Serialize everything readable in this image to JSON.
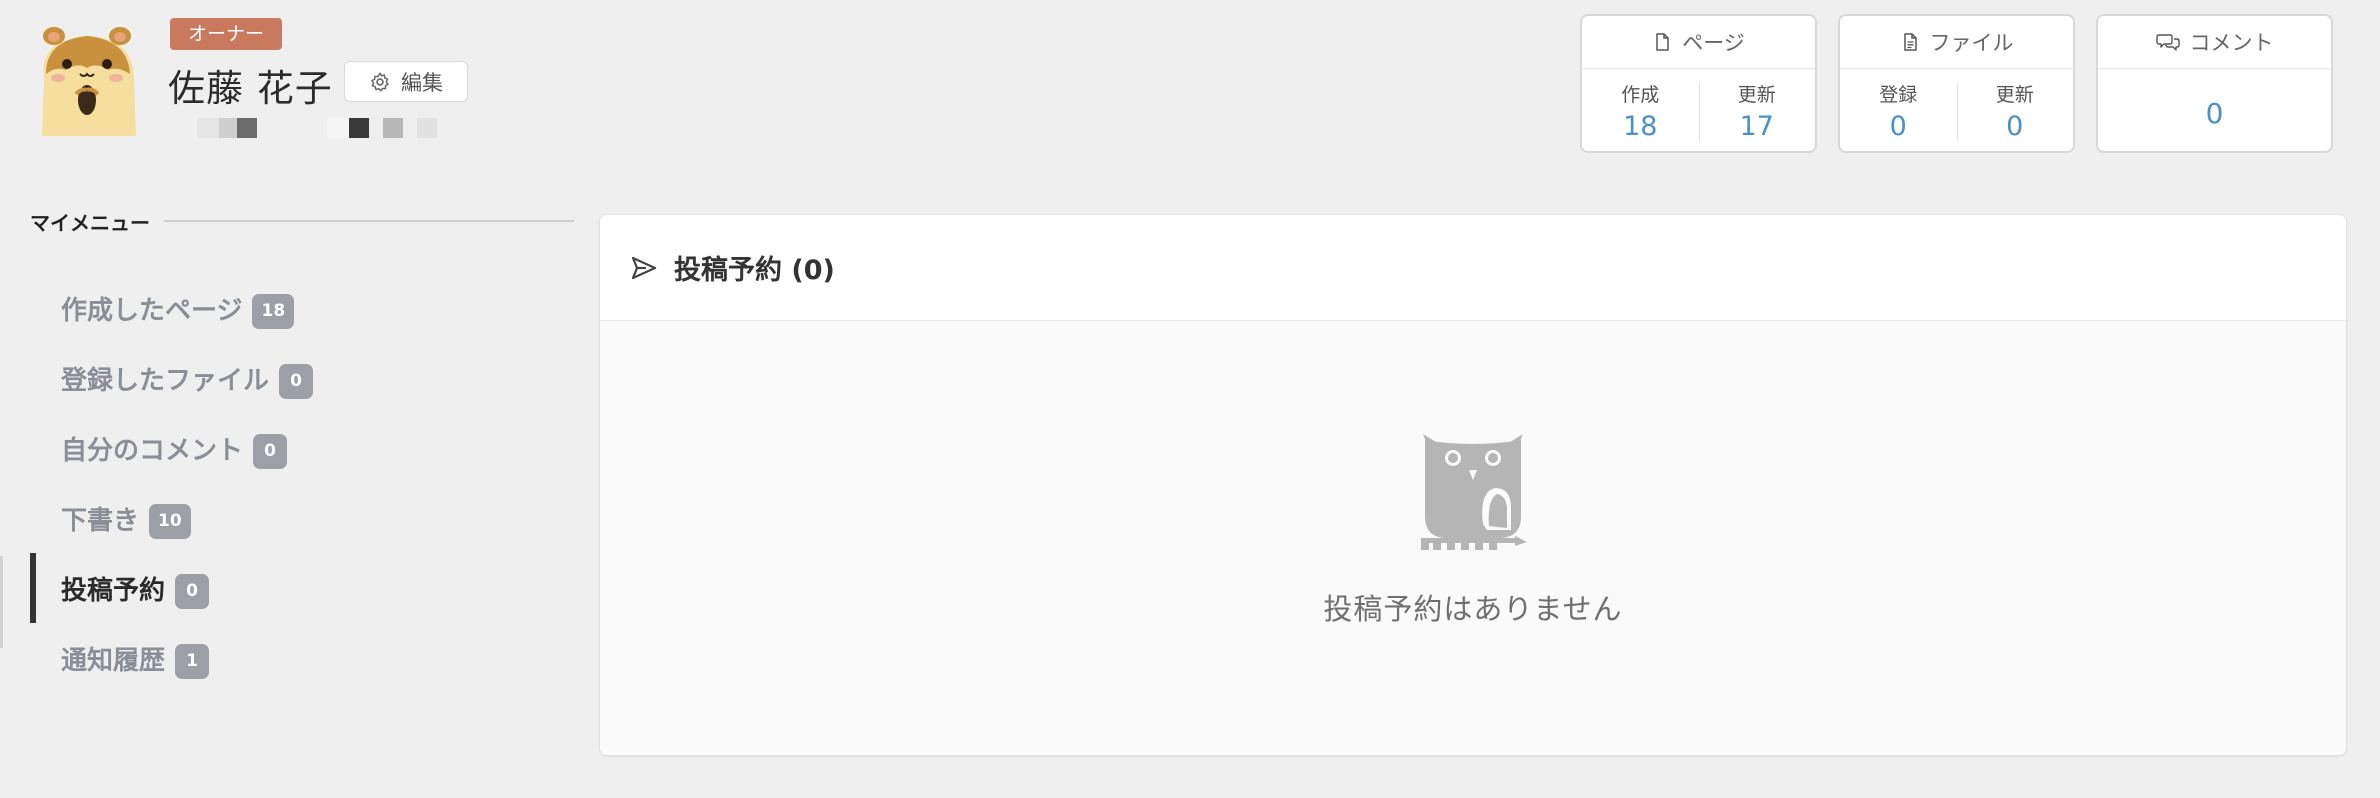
{
  "profile": {
    "owner_badge": "オーナー",
    "name": "佐藤 花子",
    "edit_label": "編集"
  },
  "stats": {
    "pages": {
      "title": "ページ",
      "created_label": "作成",
      "created_value": "18",
      "updated_label": "更新",
      "updated_value": "17"
    },
    "files": {
      "title": "ファイル",
      "registered_label": "登録",
      "registered_value": "0",
      "updated_label": "更新",
      "updated_value": "0"
    },
    "comments": {
      "title": "コメント",
      "value": "0"
    }
  },
  "sidebar": {
    "heading": "マイメニュー",
    "items": [
      {
        "label": "作成したページ",
        "count": "18"
      },
      {
        "label": "登録したファイル",
        "count": "0"
      },
      {
        "label": "自分のコメント",
        "count": "0"
      },
      {
        "label": "下書き",
        "count": "10"
      },
      {
        "label": "投稿予約",
        "count": "0",
        "active": true
      },
      {
        "label": "通知履歴",
        "count": "1"
      }
    ]
  },
  "main": {
    "title": "投稿予約 (0)",
    "empty_message": "投稿予約はありません"
  },
  "colors": {
    "owner_badge": "#c97a5e",
    "accent_value": "#4a90c8",
    "count_badge": "#9c9fa6",
    "background": "#efefef"
  }
}
